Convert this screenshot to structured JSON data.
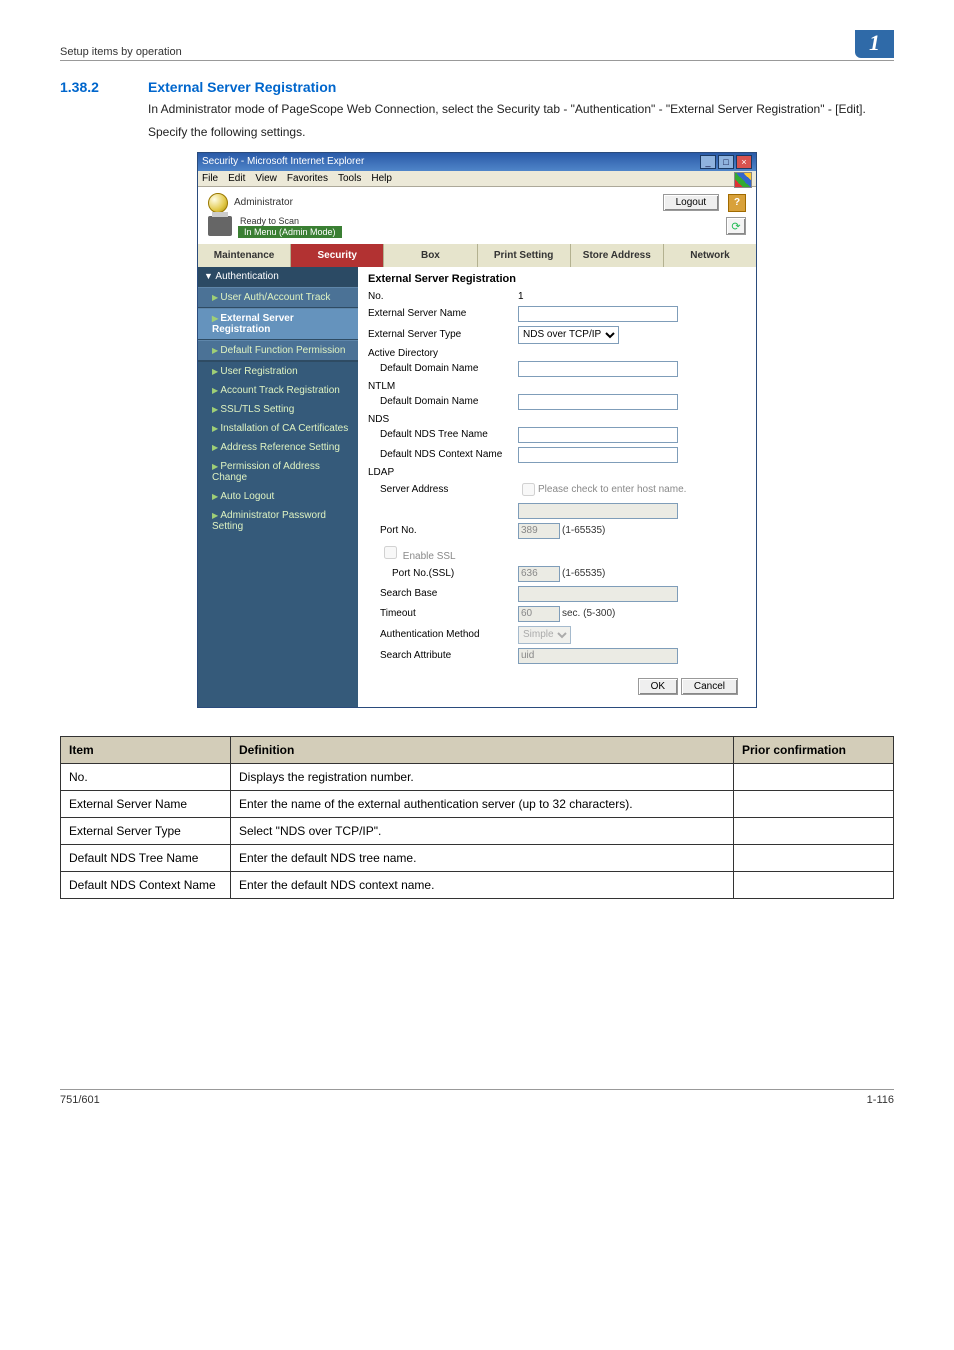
{
  "runhead": {
    "left": "Setup items by operation",
    "chapter": "1"
  },
  "section": {
    "number": "1.38.2",
    "title": "External Server Registration",
    "para1": "In Administrator mode of PageScope Web Connection, select the Security tab - \"Authentication\" - \"External Server Registration\" - [Edit].",
    "para2": "Specify the following settings."
  },
  "ie": {
    "title": "Security - Microsoft Internet Explorer",
    "menu": {
      "file": "File",
      "edit": "Edit",
      "view": "View",
      "favorites": "Favorites",
      "tools": "Tools",
      "help": "Help"
    },
    "win": {
      "min": "_",
      "max": "□",
      "close": "×"
    }
  },
  "app": {
    "role": "Administrator",
    "logout": "Logout",
    "help": "?",
    "status_ready": "Ready to Scan",
    "status_mode": "In Menu (Admin Mode)",
    "refresh": "⟳",
    "tabs": {
      "maintenance": "Maintenance",
      "security": "Security",
      "box": "Box",
      "print": "Print Setting",
      "store": "Store Address",
      "network": "Network"
    },
    "sidebar": {
      "authentication": "Authentication",
      "user_auth": "User Auth/Account Track",
      "ext_server": "External Server Registration",
      "default_func": "Default Function Permission",
      "user_reg": "User Registration",
      "acct_track": "Account Track Registration",
      "ssl": "SSL/TLS Setting",
      "ca": "Installation of CA Certificates",
      "addr_ref": "Address Reference Setting",
      "perm_addr": "Permission of Address Change",
      "auto_logout": "Auto Logout",
      "admin_pw": "Administrator Password Setting"
    },
    "form": {
      "heading": "External Server Registration",
      "no_label": "No.",
      "no_value": "1",
      "ext_name_label": "External Server Name",
      "ext_type_label": "External Server Type",
      "ext_type_value": "NDS over TCP/IP",
      "ad_header": "Active Directory",
      "ad_domain_label": "Default Domain Name",
      "ntlm_header": "NTLM",
      "ntlm_domain_label": "Default Domain Name",
      "nds_header": "NDS",
      "nds_tree_label": "Default NDS Tree Name",
      "nds_ctx_label": "Default NDS Context Name",
      "ldap_header": "LDAP",
      "server_addr_label": "Server Address",
      "server_addr_chk": "Please check to enter host name.",
      "port_label": "Port No.",
      "port_value": "389",
      "port_range": "(1-65535)",
      "enable_ssl_label": "Enable SSL",
      "port_ssl_label": "Port No.(SSL)",
      "port_ssl_value": "636",
      "port_ssl_range": "(1-65535)",
      "search_base_label": "Search Base",
      "timeout_label": "Timeout",
      "timeout_value": "60",
      "timeout_unit": "sec. (5-300)",
      "auth_method_label": "Authentication Method",
      "auth_method_value": "Simple",
      "search_attr_label": "Search Attribute",
      "search_attr_value": "uid",
      "ok": "OK",
      "cancel": "Cancel"
    }
  },
  "def_table": {
    "headers": {
      "item": "Item",
      "definition": "Definition",
      "prior": "Prior confirmation"
    },
    "rows": [
      {
        "item": "No.",
        "definition": "Displays the registration number."
      },
      {
        "item": "External Server Name",
        "definition": "Enter the name of the external authentication server (up to 32 characters)."
      },
      {
        "item": "External Server Type",
        "definition": "Select \"NDS over TCP/IP\"."
      },
      {
        "item": "Default NDS Tree Name",
        "definition": "Enter the default NDS tree name."
      },
      {
        "item": "Default NDS Context Name",
        "definition": "Enter the default NDS context name."
      }
    ]
  },
  "footer": {
    "left": "751/601",
    "right": "1-116"
  }
}
